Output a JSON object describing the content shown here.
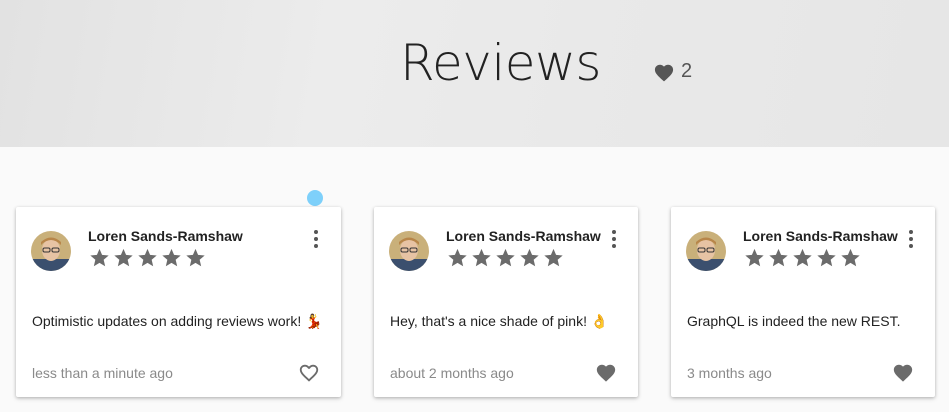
{
  "header": {
    "title": "Reviews",
    "favorite_count": "2"
  },
  "reviews": [
    {
      "author": "Loren Sands-Ramshaw",
      "rating": 5,
      "text": "Optimistic updates on adding reviews work! 💃",
      "time": "less than a minute ago",
      "favorited": false
    },
    {
      "author": "Loren Sands-Ramshaw",
      "rating": 5,
      "text": "Hey, that's a nice shade of pink! 👌",
      "time": "about 2 months ago",
      "favorited": true
    },
    {
      "author": "Loren Sands-Ramshaw",
      "rating": 5,
      "text": "GraphQL is indeed the new REST.",
      "time": "3 months ago",
      "favorited": true
    }
  ],
  "icons": {
    "favorite": "heart-icon",
    "rating": "star-icon",
    "menu": "more-vert-icon"
  },
  "colors": {
    "icon_gray": "#6b6b6b",
    "cursor_dot": "#7ed0fa"
  }
}
